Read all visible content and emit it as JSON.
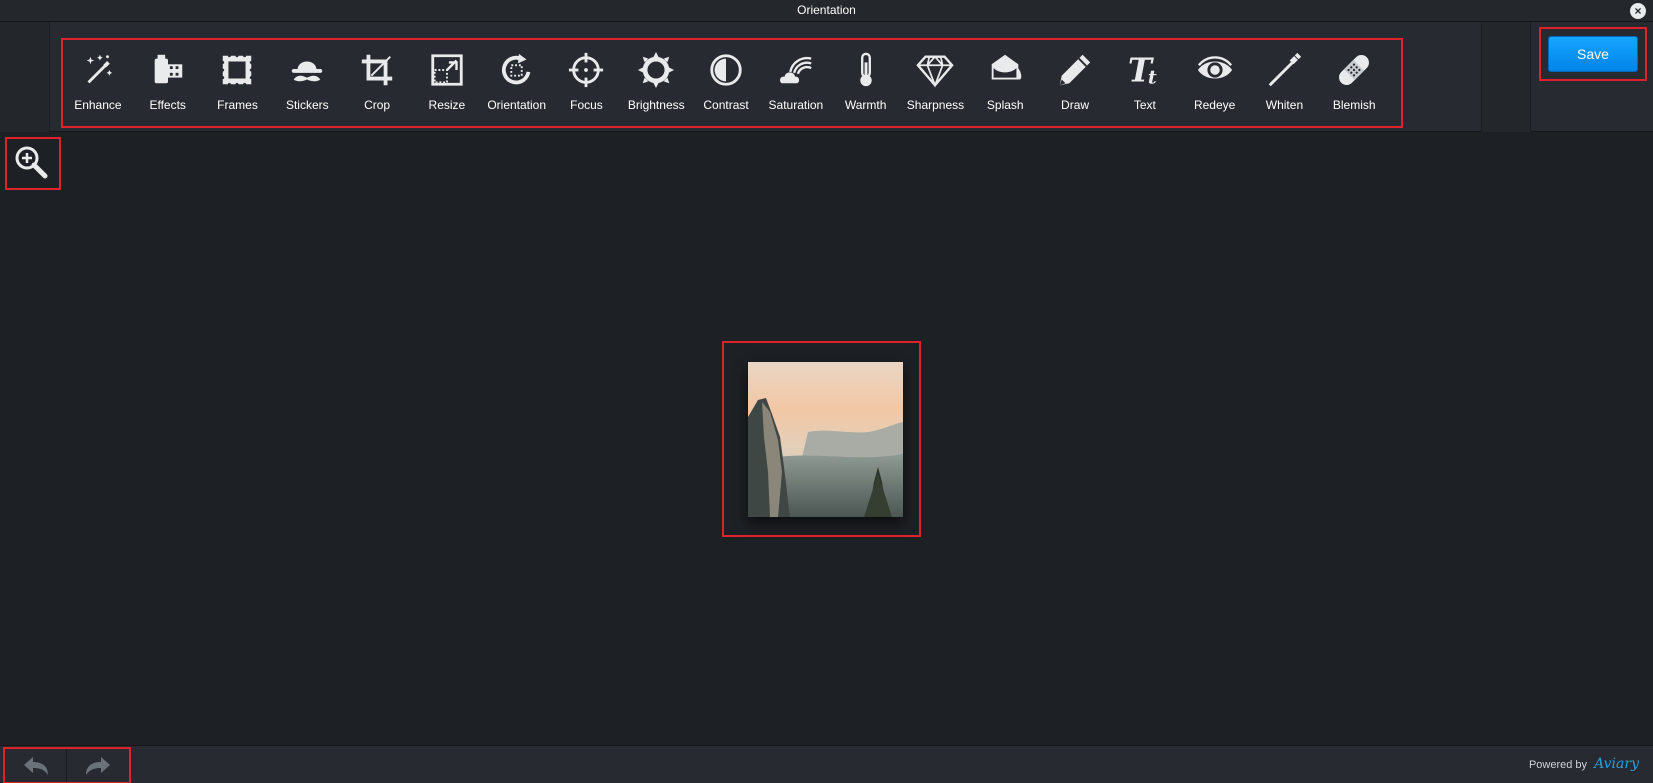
{
  "window": {
    "title": "Orientation",
    "close_label": "×"
  },
  "toolbar": {
    "tools": [
      {
        "id": "enhance",
        "label": "Enhance",
        "icon": "magic-wand-icon"
      },
      {
        "id": "effects",
        "label": "Effects",
        "icon": "film-roll-icon"
      },
      {
        "id": "frames",
        "label": "Frames",
        "icon": "frame-icon"
      },
      {
        "id": "stickers",
        "label": "Stickers",
        "icon": "hat-mustache-icon"
      },
      {
        "id": "crop",
        "label": "Crop",
        "icon": "crop-icon"
      },
      {
        "id": "resize",
        "label": "Resize",
        "icon": "resize-icon"
      },
      {
        "id": "orientation",
        "label": "Orientation",
        "icon": "rotate-icon"
      },
      {
        "id": "focus",
        "label": "Focus",
        "icon": "crosshair-icon"
      },
      {
        "id": "brightness",
        "label": "Brightness",
        "icon": "sun-icon"
      },
      {
        "id": "contrast",
        "label": "Contrast",
        "icon": "contrast-icon"
      },
      {
        "id": "saturation",
        "label": "Saturation",
        "icon": "rainbow-cloud-icon"
      },
      {
        "id": "warmth",
        "label": "Warmth",
        "icon": "thermometer-icon"
      },
      {
        "id": "sharpness",
        "label": "Sharpness",
        "icon": "diamond-icon"
      },
      {
        "id": "splash",
        "label": "Splash",
        "icon": "paint-bucket-icon"
      },
      {
        "id": "draw",
        "label": "Draw",
        "icon": "pencil-icon"
      },
      {
        "id": "text",
        "label": "Text",
        "icon": "text-icon"
      },
      {
        "id": "redeye",
        "label": "Redeye",
        "icon": "eye-icon"
      },
      {
        "id": "whiten",
        "label": "Whiten",
        "icon": "toothbrush-icon"
      },
      {
        "id": "blemish",
        "label": "Blemish",
        "icon": "bandage-icon"
      }
    ],
    "save_label": "Save"
  },
  "footer": {
    "powered_by": "Powered by",
    "brand": "Aviary"
  },
  "colors": {
    "accent": "#0a96f5",
    "highlight": "#e0222a",
    "background": "#1d2024"
  }
}
